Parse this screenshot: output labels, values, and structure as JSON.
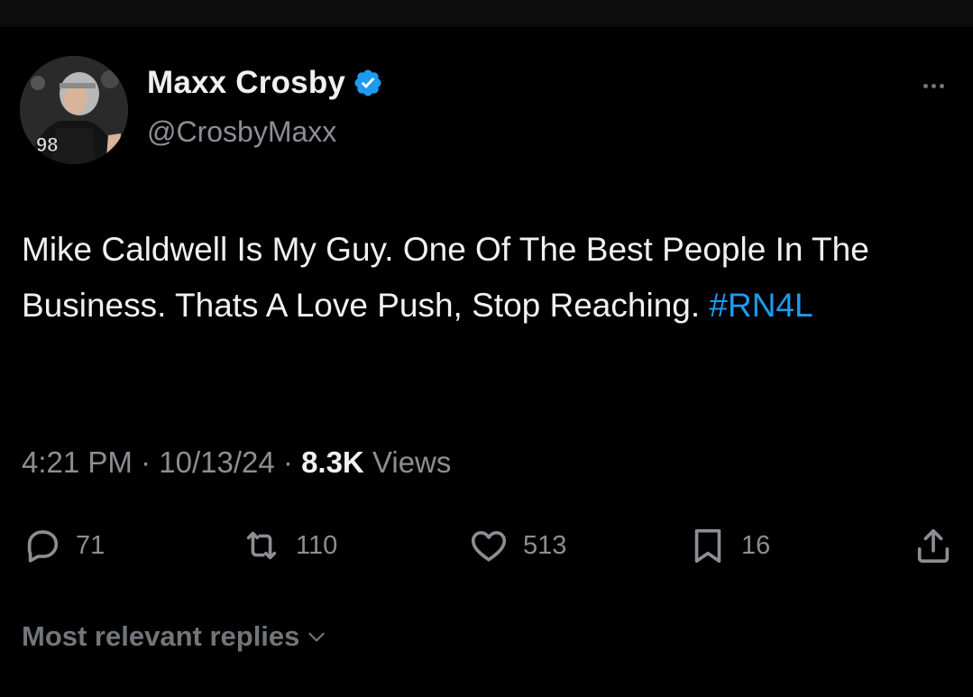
{
  "tweet": {
    "author": {
      "display_name": "Maxx Crosby",
      "handle": "@CrosbyMaxx",
      "verified": true,
      "avatar_icon": "player-avatar",
      "jersey_number": "98"
    },
    "text": "Mike Caldwell Is My Guy. One Of The Best People In The Business. Thats A Love Push, Stop Reaching.",
    "hashtag": "#RN4L",
    "time": "4:21 PM",
    "date": "10/13/24",
    "separator": "·",
    "views_count": "8.3K",
    "views_label": "Views"
  },
  "actions": {
    "replies": "71",
    "reposts": "110",
    "likes": "513",
    "bookmarks": "16"
  },
  "replies_sort": {
    "label": "Most relevant replies"
  },
  "colors": {
    "background": "#000000",
    "text": "#e7e9ea",
    "muted": "#8b8f94",
    "link": "#1d9bf0",
    "verified": "#1d9bf0"
  }
}
